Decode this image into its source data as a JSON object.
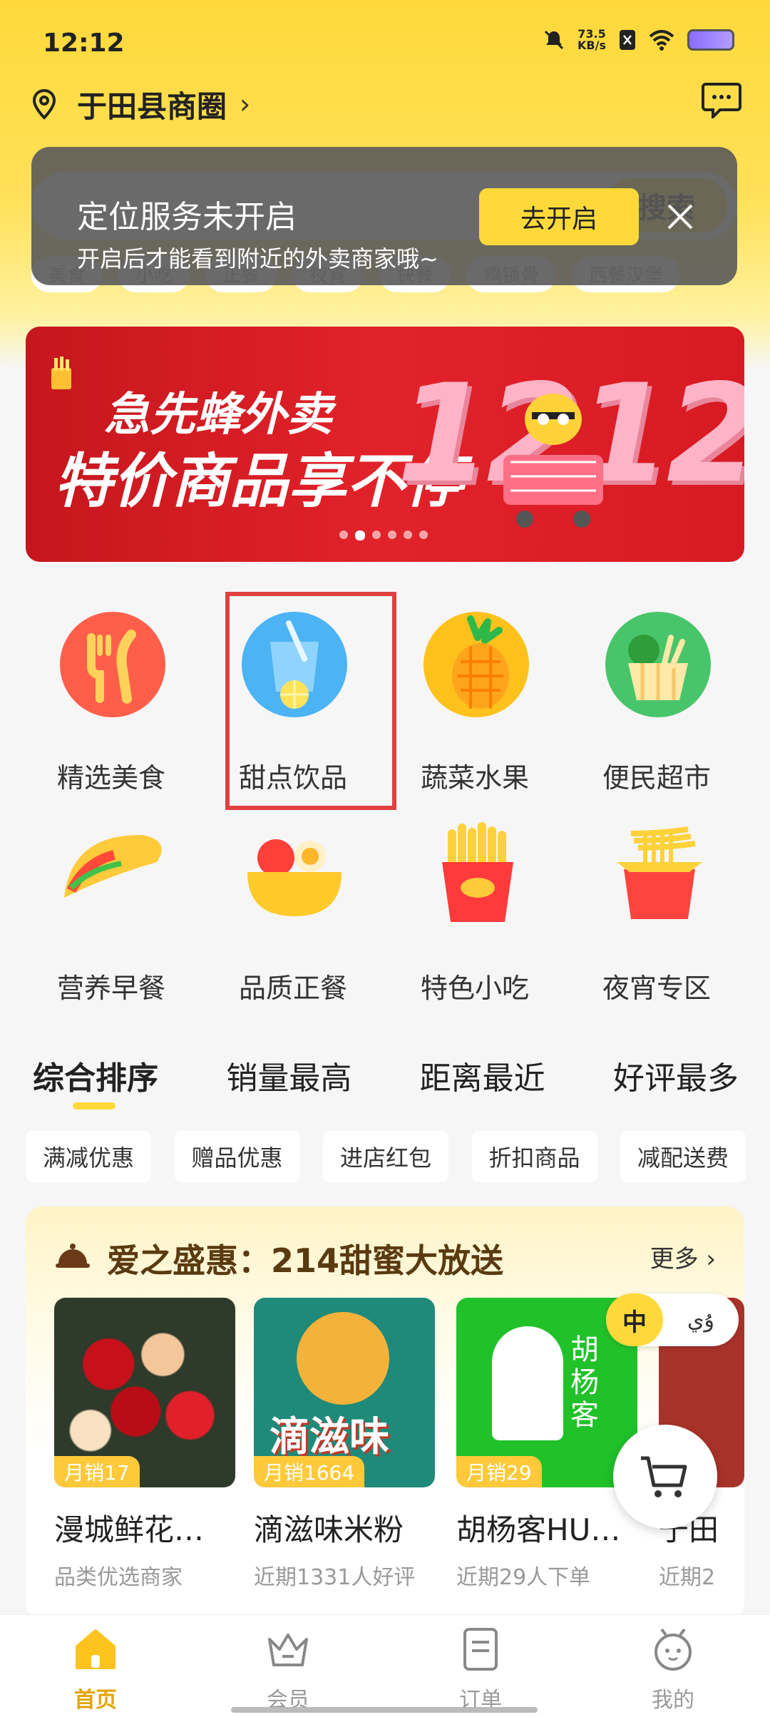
{
  "status_bar": {
    "time": "12:12",
    "net_speed_value": "73.5",
    "net_speed_unit": "KB/s"
  },
  "header": {
    "location": "于田县商圈",
    "chevron": "›"
  },
  "search": {
    "button_label": "搜索",
    "tags": [
      "美食",
      "小吃",
      "正餐",
      "夜宵",
      "快餐",
      "鸡锁骨",
      "西餐汉堡"
    ]
  },
  "toast": {
    "title": "定位服务未开启",
    "subtitle": "开启后才能看到附近的外卖商家哦~",
    "action_label": "去开启"
  },
  "banner": {
    "line1": "急先蜂外卖",
    "line2": "特价商品享不停",
    "promo_number": "1212",
    "slide_count": 6,
    "active_slide": 2
  },
  "categories": [
    {
      "label": "精选美食",
      "icon": "fork-knife-icon"
    },
    {
      "label": "甜点饮品",
      "icon": "drink-cup-icon"
    },
    {
      "label": "蔬菜水果",
      "icon": "pineapple-icon"
    },
    {
      "label": "便民超市",
      "icon": "basket-icon"
    },
    {
      "label": "营养早餐",
      "icon": "taco-icon"
    },
    {
      "label": "品质正餐",
      "icon": "rice-bowl-icon"
    },
    {
      "label": "特色小吃",
      "icon": "fries-icon"
    },
    {
      "label": "夜宵专区",
      "icon": "noodle-box-icon"
    }
  ],
  "sort_tabs": [
    "综合排序",
    "销量最高",
    "距离最近",
    "好评最多"
  ],
  "filters": [
    "满减优惠",
    "赠品优惠",
    "进店红包",
    "折扣商品",
    "减配送费"
  ],
  "promo": {
    "title": "爱之盛惠：214甜蜜大放送",
    "more": "更多 ›",
    "cards": [
      {
        "sales": "月销17",
        "name": "漫城鲜花…",
        "desc": "品类优选商家"
      },
      {
        "sales": "月销1664",
        "name": "滴滋味米粉",
        "desc": "近期1331人好评",
        "img_text": "滴滋味"
      },
      {
        "sales": "月销29",
        "name": "胡杨客HU…",
        "desc": "近期29人下单",
        "img_text": "胡杨客"
      },
      {
        "sales": "",
        "name": "于田",
        "desc": "近期2"
      }
    ]
  },
  "lang_toggle": {
    "zh": "中",
    "ug": "ۇي"
  },
  "bottom_nav": [
    {
      "label": "首页",
      "icon": "home-icon",
      "active": true
    },
    {
      "label": "会员",
      "icon": "crown-icon",
      "active": false
    },
    {
      "label": "订单",
      "icon": "order-icon",
      "active": false
    },
    {
      "label": "我的",
      "icon": "profile-icon",
      "active": false
    }
  ],
  "colors": {
    "brand_yellow": "#ffd93a",
    "highlight_red": "#e04040",
    "nav_active": "#e5a400"
  }
}
